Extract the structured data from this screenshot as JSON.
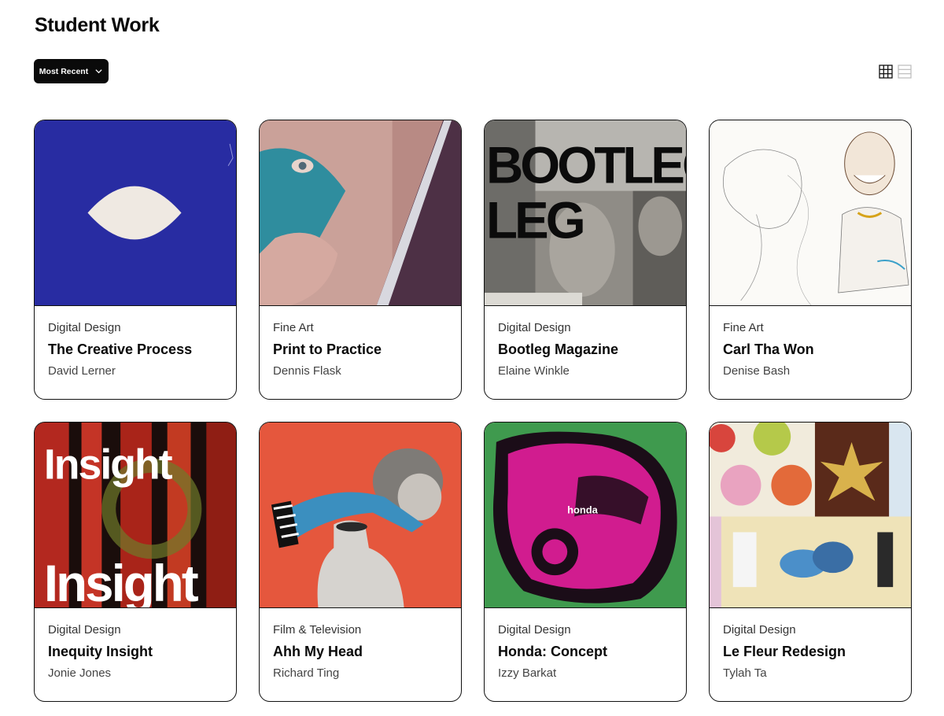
{
  "page": {
    "title": "Student Work"
  },
  "sort": {
    "label": "Most Recent"
  },
  "view_toggle": {
    "active": "grid"
  },
  "cards": [
    {
      "category": "Digital Design",
      "title": "The Creative Process",
      "author": "David Lerner"
    },
    {
      "category": "Fine Art",
      "title": "Print to Practice",
      "author": "Dennis Flask"
    },
    {
      "category": "Digital Design",
      "title": "Bootleg Magazine",
      "author": "Elaine Winkle",
      "image_text": [
        "BOOTLEG"
      ]
    },
    {
      "category": "Fine Art",
      "title": "Carl Tha Won",
      "author": "Denise Bash"
    },
    {
      "category": "Digital Design",
      "title": "Inequity Insight",
      "author": "Jonie Jones",
      "image_text": [
        "Insight",
        "Insight"
      ]
    },
    {
      "category": "Film & Television",
      "title": "Ahh My Head",
      "author": "Richard Ting"
    },
    {
      "category": "Digital Design",
      "title": "Honda: Concept",
      "author": "Izzy Barkat",
      "image_text": [
        "honda"
      ]
    },
    {
      "category": "Digital Design",
      "title": "Le Fleur Redesign",
      "author": "Tylah Ta"
    }
  ]
}
